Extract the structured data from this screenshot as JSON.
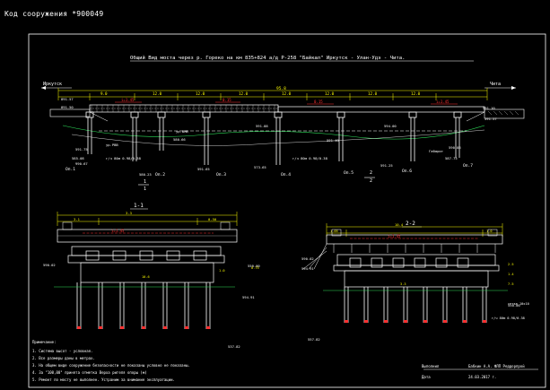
{
  "header": {
    "object_code": "Код сооружения  *900049",
    "title": "Общий Вид моста через р. Гореко на км 835+824 а/д Р-258 \"Байкал\" Иркутск - Улан-Удэ - Чита."
  },
  "directions": {
    "left": "Иркутск",
    "right": "Чита"
  },
  "elevation": {
    "total_length": "95.8",
    "span_lengths": [
      "9.0",
      "12.0",
      "12.0",
      "12.0",
      "12.0",
      "12.0",
      "12.0",
      "12.0"
    ],
    "slopes": [
      "i=1.45",
      "0.15",
      "0.15",
      "i=1.45"
    ],
    "supports": [
      "Оп.1",
      "Оп.2",
      "Оп.3",
      "Оп.4",
      "Оп.5",
      "Оп.6",
      "Оп.7"
    ],
    "marks": [
      "891.57",
      "891.50",
      "591.75",
      "990.67",
      "580.23",
      "580.66",
      "591.65",
      "591.88",
      "573.65",
      "591.40",
      "594.00",
      "591.25",
      "590.86",
      "587.75",
      "591.10",
      "585.08",
      "591.57"
    ],
    "notes": [
      "ур.РВВ",
      "ур.ВМВ",
      "г/ч 80м 0.98/0.38",
      "г/ч 80м 0.98/0.38",
      "Габарит"
    ],
    "cut_markers": [
      "1",
      "1",
      "2",
      "2"
    ]
  },
  "section_1": {
    "title": "1-1",
    "dims": [
      "3.3",
      "3.1",
      "0.50",
      "0.75",
      "10.6",
      "1.0"
    ],
    "slope": "i=1.45",
    "marks": [
      "590.02",
      "594.91",
      "550.00",
      "537.82"
    ]
  },
  "section_2": {
    "title": "2-2",
    "dims": [
      "10.4",
      "1.05",
      "1.0",
      "2.5",
      "1.4",
      "3.3",
      "7.5"
    ],
    "slope": "i=1.45",
    "marks": [
      "590.02",
      "594.91",
      "550.00",
      "557.82"
    ],
    "notes": [
      "сетка 10х10",
      "г/ч 80м 0.98/0.38"
    ]
  },
  "legend": {
    "heading": "Примечание:",
    "items": [
      "1. Система высот - условная.",
      "2. Все размеры даны в метрах.",
      "3. На общем виде сооружение безопасности не показаны условно не показаны.",
      "4. За \"100,00\" принята отметка Верха ригеля опоры (м)",
      "5. Ремонт по мосту не выполнен. Устраним за внимание эксплуатации."
    ]
  },
  "stamp": {
    "author_label": "Выполнил",
    "author_name": "Бабкин А.А. ФЛП Реддорпрой",
    "date_label": "Дата",
    "date_value": "24.03.2017 г."
  },
  "colors": {
    "background": "#000000",
    "main": "#ffffff",
    "dimension": "#ffff00",
    "slope": "#ff3030",
    "ground": "#2ee05a",
    "frame": "#ffffff"
  }
}
